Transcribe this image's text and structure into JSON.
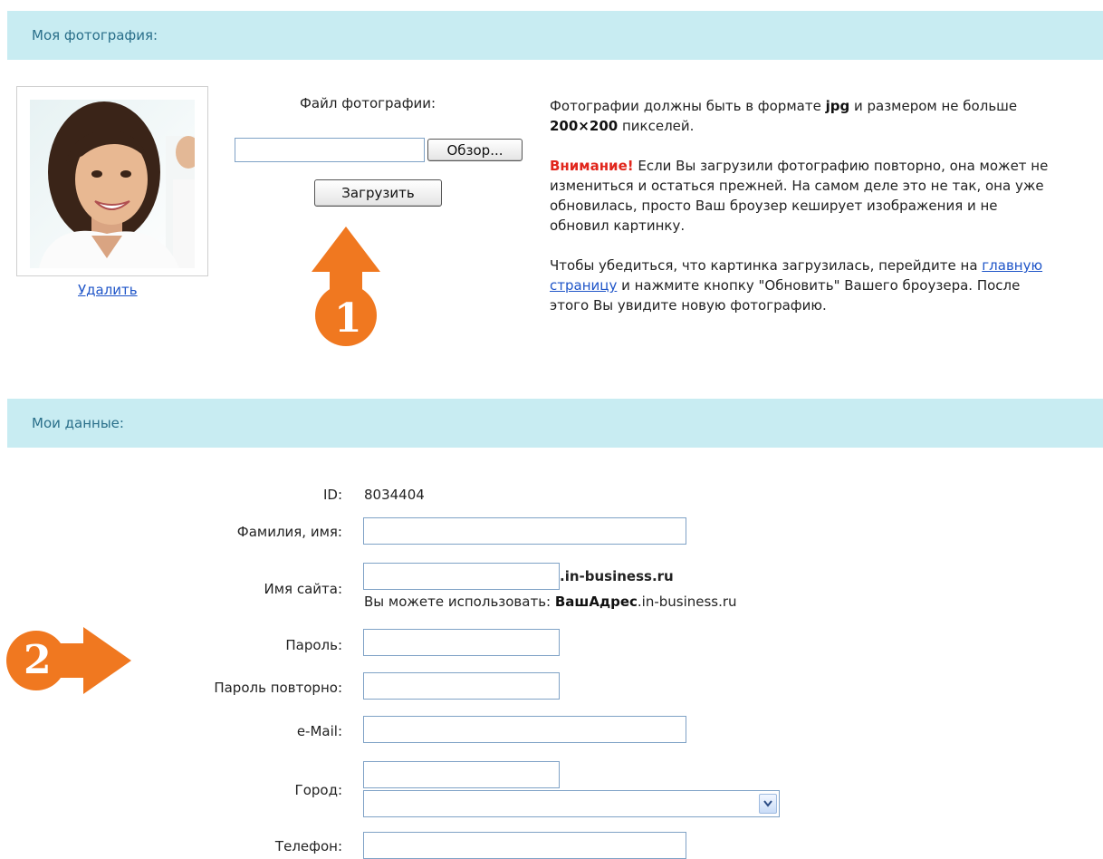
{
  "photo_section": {
    "title": "Моя фотография:",
    "delete_link": "Удалить",
    "file_label": "Файл фотографии:",
    "browse_button": "Обзор...",
    "upload_button": "Загрузить",
    "info": {
      "p1_a": "Фотографии должны быть в формате ",
      "p1_b": "jpg",
      "p1_c": " и размером не больше ",
      "p1_d": "200×200",
      "p1_e": " пикселей.",
      "p2_warning": "Внимание!",
      "p2_text": " Если Вы загрузили фотографию повторно, она может не измениться и остаться прежней. На самом деле это не так, она уже обновилась, просто Ваш броузер кеширует изображения и не обновил картинку.",
      "p3_a": "Чтобы убедиться, что картинка загрузилась, перейдите на ",
      "p3_link": "главную страницу",
      "p3_b": " и нажмите кнопку \"Обновить\" Вашего броузера. После этого Вы увидите новую фотографию."
    }
  },
  "data_section": {
    "title": "Мои данные:",
    "id_label": "ID:",
    "id_value": "8034404",
    "name_label": "Фамилия, имя:",
    "site_label": "Имя сайта:",
    "site_suffix": ".in-business.ru",
    "site_hint_a": "Вы можете использовать: ",
    "site_hint_b": "ВашАдрес",
    "site_hint_c": ".in-business.ru",
    "password_label": "Пароль:",
    "password_repeat_label": "Пароль повторно:",
    "email_label": "e-Mail:",
    "city_label": "Город:",
    "phone_label": "Телефон:"
  },
  "annotations": {
    "marker_1": "1",
    "marker_2": "2",
    "color": "#f07820"
  }
}
